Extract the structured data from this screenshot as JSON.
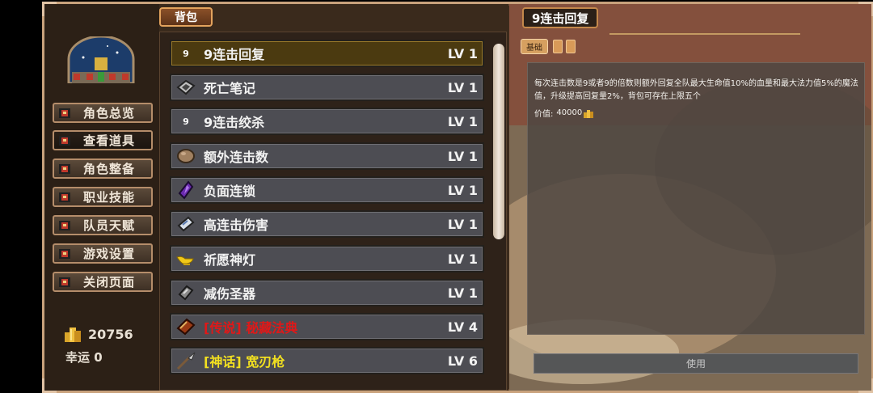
{
  "sidebar": {
    "menu": [
      {
        "label": "角色总览"
      },
      {
        "label": "查看道具"
      },
      {
        "label": "角色整备"
      },
      {
        "label": "职业技能"
      },
      {
        "label": "队员天赋"
      },
      {
        "label": "游戏设置"
      },
      {
        "label": "关闭页面"
      }
    ],
    "active_index": 1,
    "gold": "20756",
    "luck": "幸运 0"
  },
  "bag": {
    "tab_label": "背包",
    "items": [
      {
        "name": "9连击回复",
        "level": "LV 1",
        "icon": "nine-badge-icon",
        "icon_text": "9",
        "name_color": "#f2f2f2",
        "selected": true
      },
      {
        "name": "死亡笔记",
        "level": "LV 1",
        "icon": "death-note-icon",
        "icon_text": "",
        "name_color": "#f2f2f2"
      },
      {
        "name": "9连击绞杀",
        "level": "LV 1",
        "icon": "nine-badge-icon",
        "icon_text": "9",
        "name_color": "#f2f2f2"
      },
      {
        "name": "额外连击数",
        "level": "LV 1",
        "icon": "stone-icon",
        "icon_text": "",
        "name_color": "#f2f2f2"
      },
      {
        "name": "负面连锁",
        "level": "LV 1",
        "icon": "purple-crystal-icon",
        "icon_text": "",
        "name_color": "#f2f2f2"
      },
      {
        "name": "高连击伤害",
        "level": "LV 1",
        "icon": "scroll-icon",
        "icon_text": "",
        "name_color": "#f2f2f2"
      },
      {
        "name": "祈愿神灯",
        "level": "LV 1",
        "icon": "magic-lamp-icon",
        "icon_text": "",
        "name_color": "#f2f2f2"
      },
      {
        "name": "减伤圣器",
        "level": "LV 1",
        "icon": "relic-icon",
        "icon_text": "",
        "name_color": "#f2f2f2"
      },
      {
        "name": "[传说] 秘藏法典",
        "level": "LV 4",
        "icon": "book-icon",
        "icon_text": "",
        "name_color": "#e01818"
      },
      {
        "name": "[神话] 宽刃枪",
        "level": "LV 6",
        "icon": "spear-icon",
        "icon_text": "",
        "name_color": "#f2e020"
      }
    ]
  },
  "detail": {
    "title": "9连击回复",
    "tag": "基础",
    "description": "每次连击数是9或者9的倍数则额外回复全队最大生命值10%的血量和最大法力值5%的魔法值，升级提高回复量2%，背包可存在上限五个",
    "value_label": "价值:",
    "value": "40000",
    "use_label": "使用"
  },
  "colors": {
    "frame": "#c9a27c",
    "selected_row": "#4b3a10",
    "legend_red": "#e01818",
    "myth_yellow": "#f2e020"
  }
}
